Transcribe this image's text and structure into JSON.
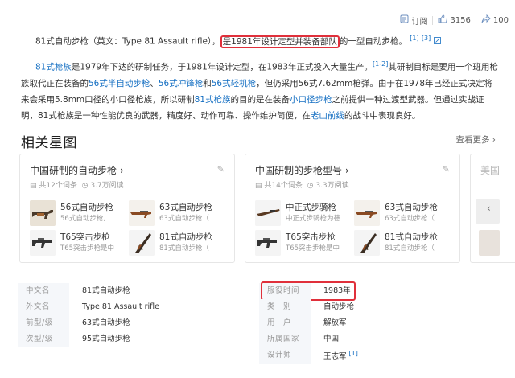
{
  "topbar": {
    "subscribe_label": "订阅",
    "like_count": "3156",
    "share_count": "100"
  },
  "intro": {
    "p1_before": "81式自动步枪（英文：Type 81 Assault rifle），",
    "p1_highlight": "是1981年设计定型并装备部队",
    "p1_after": "的一型自动步枪。",
    "p1_ref1": "[1]",
    "p1_ref2": "[3]",
    "p2_link1": "81式枪族",
    "p2_t1": "是1979年下达的研制任务，于1981年设计定型，在1983年正式投入大量生产。",
    "p2_ref": "[1-2]",
    "p2_t2": "其研制目标是要用一个班用枪族取代正在装备的",
    "p2_link2": "56式半自动步枪",
    "p2_t3": "、",
    "p2_link3": "56式冲锋枪",
    "p2_t4": "和",
    "p2_link4": "56式轻机枪",
    "p2_t5": "，但仍采用56式7.62mm枪弹。由于在1978年已经正式决定将来会采用5.8mm口径的小口径枪族，所以研制",
    "p2_link5": "81式枪族",
    "p2_t6": "的目的是在装备",
    "p2_link6": "小口径步枪",
    "p2_t7": "之前提供一种过渡型武器。但通过实战证明，81式枪族是一种性能优良的武器，精度好、动作可靠、操作维护简便，在",
    "p2_link7": "老山前线",
    "p2_t8": "的战斗中表现良好。"
  },
  "related": {
    "title": "相关星图",
    "more_label": "查看更多",
    "cards": [
      {
        "title": "中国研制的自动步枪",
        "count": "共12个词条",
        "views": "3.7万阅读",
        "items": [
          {
            "name": "56式自动步枪",
            "desc": "56式自动步枪,"
          },
          {
            "name": "63式自动步枪",
            "desc": "63式自动步枪（"
          },
          {
            "name": "T65突击步枪",
            "desc": "T65突击步枪是中"
          },
          {
            "name": "81式自动步枪",
            "desc": "81式自动步枪（"
          }
        ]
      },
      {
        "title": "中国研制的步枪型号",
        "count": "共14个词条",
        "views": "3.3万阅读",
        "items": [
          {
            "name": "中正式步骑枪",
            "desc": "中正式步骑枪为德"
          },
          {
            "name": "63式自动步枪",
            "desc": "63式自动步枪（"
          },
          {
            "name": "T65突击步枪",
            "desc": "T65突击步枪是中"
          },
          {
            "name": "81式自动步枪",
            "desc": "81式自动步枪（"
          }
        ]
      },
      {
        "title": "美国",
        "count": "",
        "views": "",
        "items": []
      }
    ]
  },
  "infobox": {
    "left": [
      {
        "label": "中文名",
        "value": "81式自动步枪",
        "is_link": false
      },
      {
        "label": "外文名",
        "value": "Type 81 Assault rifle",
        "is_link": false
      },
      {
        "label": "前型/级",
        "value": "63式自动步枪",
        "is_link": true
      },
      {
        "label": "次型/级",
        "value": "95式自动步枪",
        "is_link": true
      }
    ],
    "right": [
      {
        "label": "服役时间",
        "value": "1983年",
        "is_link": false
      },
      {
        "label": "类　别",
        "value": "自动步枪",
        "is_link": true
      },
      {
        "label": "用　户",
        "value": "解放军",
        "is_link": false
      },
      {
        "label": "所属国家",
        "value": "中国",
        "is_link": false
      },
      {
        "label": "设计师",
        "value": "王志军",
        "is_link": false,
        "ref": "[1]"
      }
    ]
  },
  "colors": {
    "link": "#136ec2",
    "highlight_border": "#e0303b"
  }
}
